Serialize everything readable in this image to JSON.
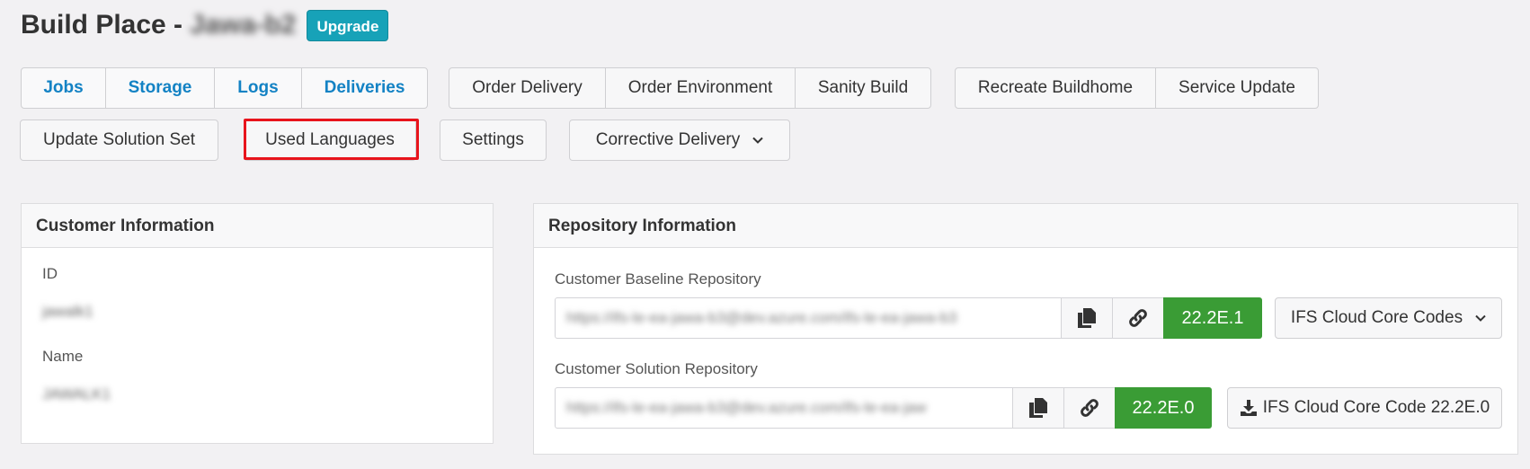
{
  "header": {
    "title_prefix": "Build Place -",
    "place_name": "Jawa-b2",
    "upgrade_label": "Upgrade"
  },
  "nav_group": [
    "Jobs",
    "Storage",
    "Logs",
    "Deliveries"
  ],
  "order_group": [
    "Order Delivery",
    "Order Environment",
    "Sanity Build"
  ],
  "maint_group": [
    "Recreate Buildhome",
    "Service Update"
  ],
  "row2": {
    "update_solution_set": "Update Solution Set",
    "used_languages": "Used Languages",
    "settings": "Settings",
    "corrective_delivery": "Corrective Delivery"
  },
  "customer_info": {
    "heading": "Customer Information",
    "id_label": "ID",
    "id_value": "jawalk1",
    "name_label": "Name",
    "name_value": "JAWALK1"
  },
  "repo_info": {
    "heading": "Repository Information",
    "baseline": {
      "label": "Customer Baseline Repository",
      "url": "https://ifs-le-ea-jawa-b3@dev.azure.com/ifs-le-ea-jawa-b3",
      "version": "22.2E.1",
      "dropdown": "IFS Cloud Core Codes"
    },
    "solution": {
      "label": "Customer Solution Repository",
      "url": "https://ifs-le-ea-jawa-b3@dev.azure.com/ifs-le-ea-jaw",
      "version": "22.2E.0",
      "download": "IFS Cloud Core Code 22.2E.0"
    }
  },
  "colors": {
    "accent_link": "#1382c4",
    "upgrade_badge": "#17a2b8",
    "version_badge": "#3a9c35",
    "highlight": "#e8141c"
  }
}
